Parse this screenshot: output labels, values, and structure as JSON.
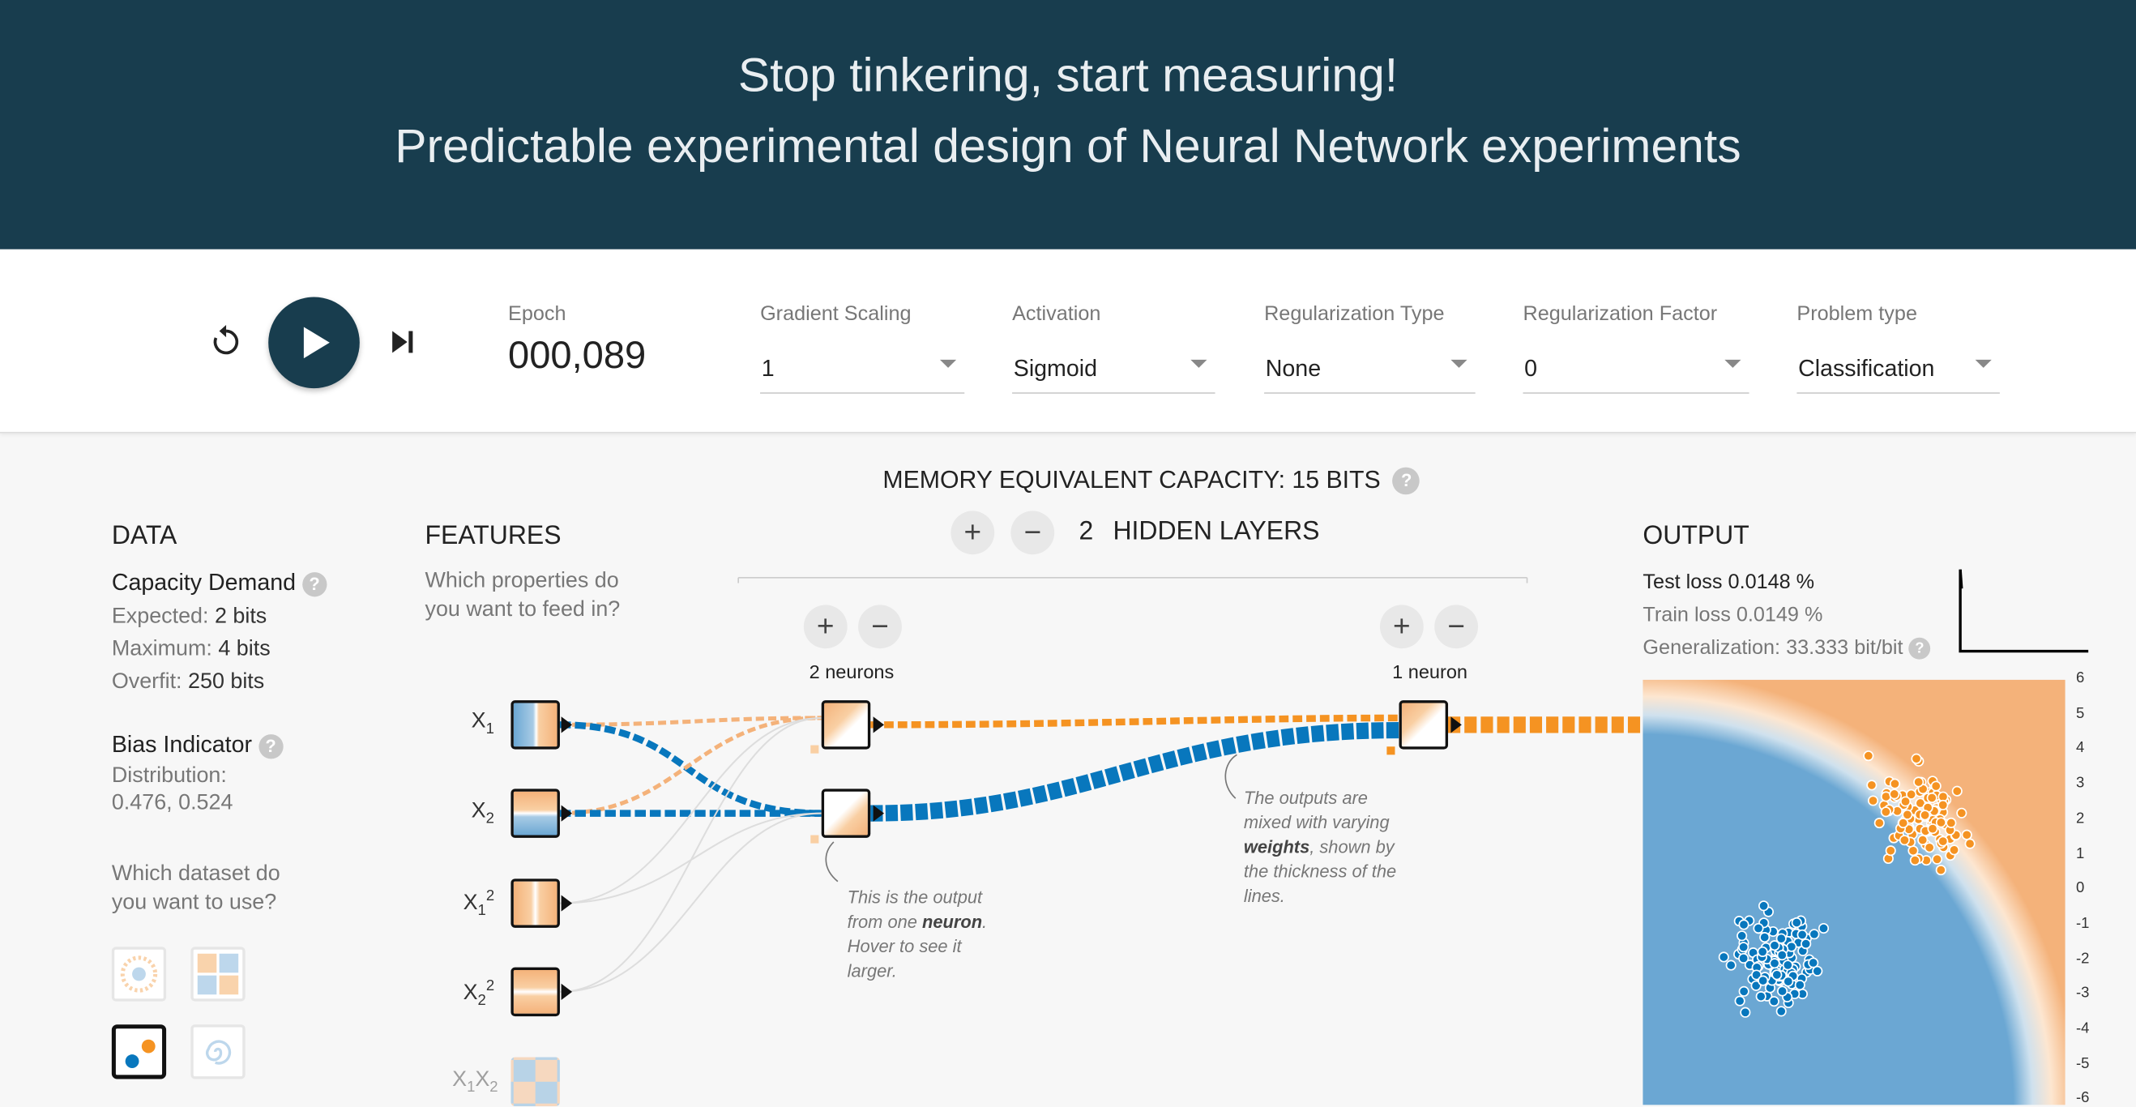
{
  "header": {
    "line1": "Stop tinkering, start measuring!",
    "line2": "Predictable experimental design of Neural Network experiments"
  },
  "controls": {
    "reset_icon": "reset-icon",
    "play_icon": "play-icon",
    "step_icon": "step-forward-icon",
    "epoch_label": "Epoch",
    "epoch_value": "000,089",
    "gradient_scaling": {
      "label": "Gradient Scaling",
      "value": "1"
    },
    "activation": {
      "label": "Activation",
      "value": "Sigmoid"
    },
    "regularization_type": {
      "label": "Regularization Type",
      "value": "None"
    },
    "regularization_factor": {
      "label": "Regularization Factor",
      "value": "0"
    },
    "problem_type": {
      "label": "Problem type",
      "value": "Classification"
    }
  },
  "network": {
    "capacity_title": "MEMORY EQUIVALENT CAPACITY: 15 BITS",
    "hidden_layers_count": "2",
    "hidden_layers_label": "HIDDEN LAYERS",
    "layer1_neurons": "2 neurons",
    "layer2_neurons": "1 neuron",
    "annotation_output": {
      "pre": "This is the output from one ",
      "bold": "neuron",
      "post": ". Hover to see it larger."
    },
    "annotation_weights": {
      "pre": "The outputs are mixed with varying ",
      "bold": "weights",
      "post": ", shown by the thickness of the lines."
    }
  },
  "data": {
    "title": "DATA",
    "capacity_demand": "Capacity Demand",
    "expected_label": "Expected:",
    "expected_value": "2 bits",
    "maximum_label": "Maximum:",
    "maximum_value": "4 bits",
    "overfit_label": "Overfit:",
    "overfit_value": "250 bits",
    "bias_indicator": "Bias Indicator",
    "distribution_label": "Distribution:",
    "distribution_value": "0.476, 0.524",
    "dataset_question": "Which dataset do you want to use?"
  },
  "features": {
    "title": "FEATURES",
    "question": "Which properties do you want to feed in?",
    "items": [
      {
        "base": "X",
        "sub": "1",
        "sup": ""
      },
      {
        "base": "X",
        "sub": "2",
        "sup": ""
      },
      {
        "base": "X",
        "sub": "1",
        "sup": "2"
      },
      {
        "base": "X",
        "sub": "2",
        "sup": "2"
      },
      {
        "base": "X",
        "sub": "1",
        "base2": "X",
        "sub2": "2"
      }
    ]
  },
  "output": {
    "title": "OUTPUT",
    "test_loss_label": "Test loss",
    "test_loss_value": "0.0148 %",
    "train_loss_label": "Train loss",
    "train_loss_value": "0.0149 %",
    "generalization_label": "Generalization:",
    "generalization_value": "33.333 bit/bit",
    "axis_ticks": [
      "6",
      "5",
      "4",
      "3",
      "2",
      "1",
      "0",
      "-1",
      "-2",
      "-3",
      "-4",
      "-5",
      "-6"
    ]
  },
  "colors": {
    "header_bg": "#183d4e",
    "orange": "#f59322",
    "blue": "#0877bd",
    "orange_light": "#f4b27a",
    "blue_light": "#6ba7d3"
  }
}
